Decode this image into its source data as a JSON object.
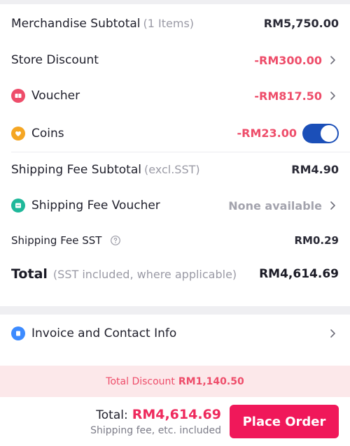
{
  "summary": {
    "merchandise": {
      "label": "Merchandise Subtotal",
      "note": "(1 Items)",
      "amount": "RM5,750.00"
    },
    "store_discount": {
      "label": "Store Discount",
      "amount": "-RM300.00"
    },
    "voucher": {
      "label": "Voucher",
      "amount": "-RM817.50"
    },
    "coins": {
      "label": "Coins",
      "amount": "-RM23.00",
      "toggle_on": true
    },
    "shipping_subtotal": {
      "label": "Shipping Fee Subtotal",
      "note": "(excl.SST)",
      "amount": "RM4.90"
    },
    "shipping_voucher": {
      "label": "Shipping Fee Voucher",
      "amount": "None available"
    },
    "shipping_sst": {
      "label": "Shipping Fee SST",
      "amount": "RM0.29"
    },
    "total": {
      "label": "Total",
      "note": "(SST included, where applicable)",
      "amount": "RM4,614.69"
    }
  },
  "invoice": {
    "label": "Invoice and Contact Info"
  },
  "discount_bar": {
    "label": "Total Discount",
    "amount": "RM1,140.50"
  },
  "checkout": {
    "total_label": "Total:",
    "total_amount": "RM4,614.69",
    "sub_label": "Shipping fee, etc. included",
    "button_label": "Place Order"
  },
  "colors": {
    "accent": "#f0185a",
    "discount_red": "#ee4d6a",
    "toggle_blue": "#1b4fb8",
    "voucher_icon": "#ee4d6a",
    "coins_icon": "#f5a623",
    "shipping_voucher_icon": "#1fb89a",
    "invoice_icon": "#3d8bff"
  },
  "icons": {
    "voucher": "ticket-icon",
    "coins": "coin-icon",
    "shipping_voucher": "shipping-ticket-icon",
    "invoice": "document-icon",
    "chevron": "chevron-right-icon",
    "help": "help-circle-icon"
  }
}
